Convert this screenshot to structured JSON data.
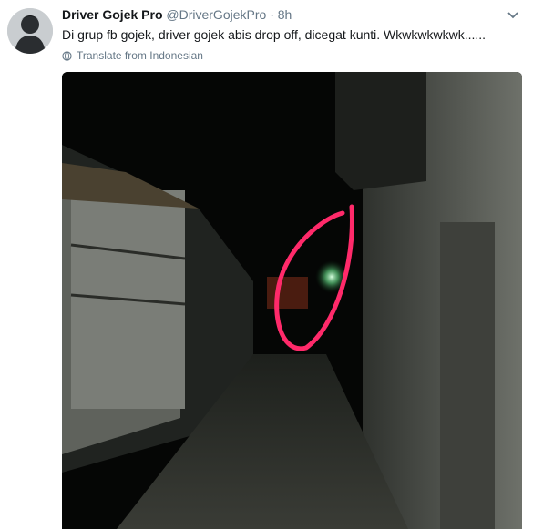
{
  "tweet": {
    "display_name": "Driver Gojek Pro",
    "handle": "@DriverGojekPro",
    "separator": "·",
    "time": "8h",
    "text": "Di grup fb gojek, driver gojek abis drop off, dicegat kunti. Wkwkwkwkwk......",
    "translate_label": "Translate from Indonesian"
  },
  "icons": {
    "avatar": "user-silhouette",
    "more": "chevron-down-icon",
    "translate": "globe-icon"
  },
  "colors": {
    "name": "#14171a",
    "meta": "#657786",
    "circle_annotation": "#ff2a6a"
  }
}
